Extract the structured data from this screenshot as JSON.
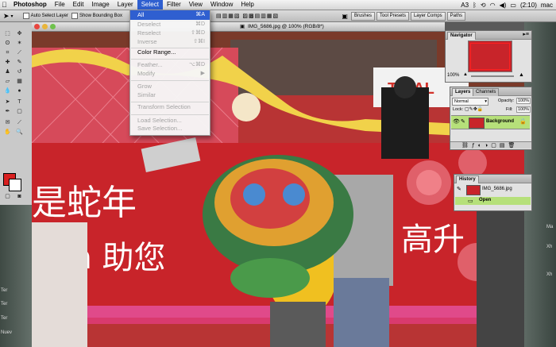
{
  "menubar": {
    "apple": "",
    "items": [
      "Photoshop",
      "File",
      "Edit",
      "Image",
      "Layer",
      "Select",
      "Filter",
      "View",
      "Window",
      "Help"
    ],
    "status_right": "(2:10)",
    "user": "mac"
  },
  "options": {
    "auto_select": "Auto Select Layer",
    "bounding_box": "Show Bounding Box",
    "panel_tabs": [
      "Brushes",
      "Tool Presets",
      "Layer Comps",
      "Paths"
    ]
  },
  "document": {
    "title": "IMG_5686.jpg @ 100% (RGB/8*)",
    "banner_zh_top": "是蛇年",
    "banner_en": "zon 助您",
    "banner_zh_right": "高升",
    "sign_text": "TICAL"
  },
  "select_menu": {
    "items": [
      {
        "label": "All",
        "shortcut": "⌘A"
      },
      {
        "label": "Deselect",
        "shortcut": "⌘D"
      },
      {
        "label": "Reselect",
        "shortcut": "⇧⌘D"
      },
      {
        "label": "Inverse",
        "shortcut": "⇧⌘I"
      },
      {
        "label": "Color Range...",
        "shortcut": ""
      },
      {
        "label": "Feather...",
        "shortcut": "⌥⌘D"
      },
      {
        "label": "Modify",
        "shortcut": "▶"
      },
      {
        "label": "Grow",
        "shortcut": ""
      },
      {
        "label": "Similar",
        "shortcut": ""
      },
      {
        "label": "Transform Selection",
        "shortcut": ""
      },
      {
        "label": "Load Selection...",
        "shortcut": ""
      },
      {
        "label": "Save Selection...",
        "shortcut": ""
      }
    ]
  },
  "navigator": {
    "title": "Navigator",
    "zoom": "100%"
  },
  "layers": {
    "tabs": [
      "Layers",
      "Channels"
    ],
    "blend_mode": "Normal",
    "opacity_label": "Opacity:",
    "opacity": "100%",
    "lock_label": "Lock:",
    "fill_label": "Fill:",
    "fill": "100%",
    "layer_name": "Background"
  },
  "history": {
    "title": "History",
    "snapshot": "IMG_5686.jpg",
    "state": "Open"
  },
  "desktop_right_labels": [
    "Ma",
    "Xh",
    "Xh"
  ],
  "desktop_left_labels": [
    "Ter",
    "Ter",
    "Ter",
    "Nuev"
  ],
  "colors": {
    "menu_highlight": "#2f5fd0",
    "foreground": "#d82020",
    "background": "#ffffff",
    "layer_selected": "#b6e07a"
  }
}
